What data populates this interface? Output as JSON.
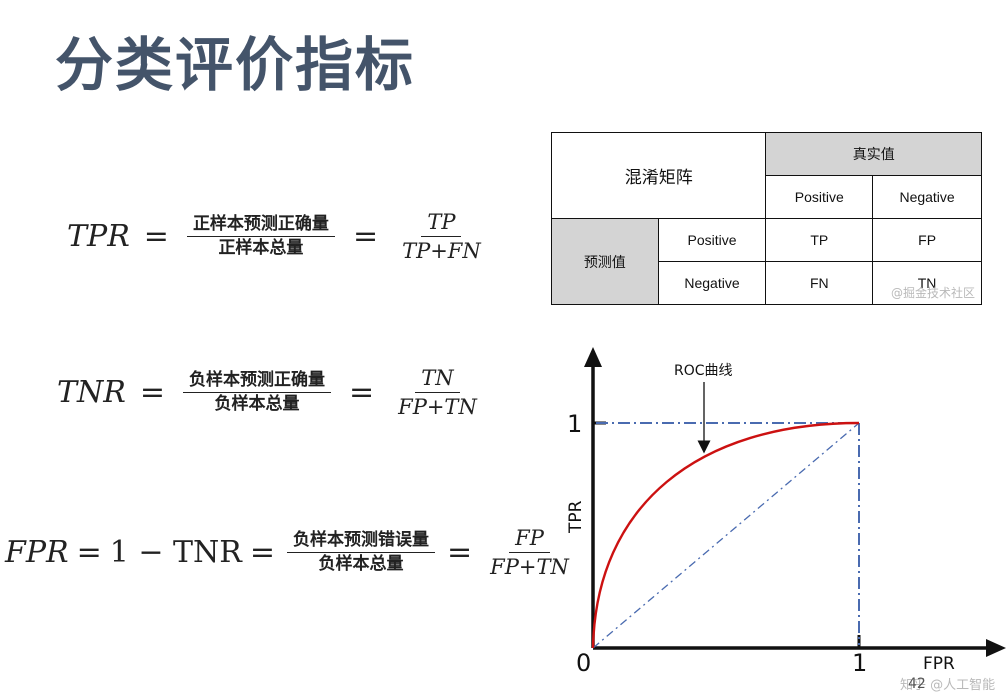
{
  "title": "分类评价指标",
  "formulas": {
    "tpr": {
      "lhs": "TPR",
      "eq": "=",
      "cn_num": "正样本预测正确量",
      "cn_den": "正样本总量",
      "eq2": "=",
      "num": "TP",
      "den": "TP+FN"
    },
    "tnr": {
      "lhs": "TNR",
      "eq": "=",
      "cn_num": "负样本预测正确量",
      "cn_den": "负样本总量",
      "eq2": "=",
      "num": "TN",
      "den": "FP+TN"
    },
    "fpr": {
      "lhs": "FPR",
      "eq": "=",
      "mid": "1 − TNR",
      "eq_mid": "=",
      "cn_num": "负样本预测错误量",
      "cn_den": "负样本总量",
      "eq2": "=",
      "num": "FP",
      "den": "FP+TN"
    }
  },
  "confusion_matrix": {
    "corner": "混淆矩阵",
    "actual_header": "真实值",
    "predicted_header": "预测值",
    "col_labels": [
      "Positive",
      "Negative"
    ],
    "row_labels": [
      "Positive",
      "Negative"
    ],
    "cells": [
      [
        "TP",
        "FP"
      ],
      [
        "FN",
        "TN"
      ]
    ],
    "colors": {
      "header_bg": "#d4d4d4"
    }
  },
  "roc": {
    "curve_label": "ROC曲线",
    "y_axis_label": "TPR",
    "x_axis_label": "FPR",
    "origin_label": "0",
    "x_tick": "1",
    "y_tick": "1",
    "colors": {
      "curve": "#cc1111",
      "dash": "#4a6bb0"
    }
  },
  "watermarks": {
    "juejin": "@掘金技术社区",
    "zhihu": "知乎 @人工智能"
  },
  "page_number": "42",
  "colors": {
    "title": "#44546a"
  }
}
